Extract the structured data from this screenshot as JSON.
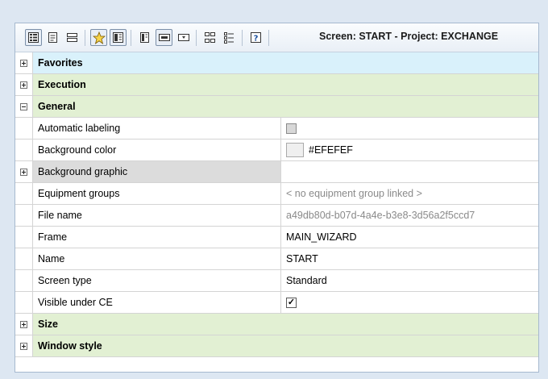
{
  "toolbar": {
    "title": "Screen: START - Project: EXCHANGE",
    "buttons": [
      {
        "icon": "categorized-view-icon",
        "active": true
      },
      {
        "icon": "properties-page-icon",
        "active": false
      },
      {
        "icon": "collapse-icon",
        "active": false
      },
      {
        "icon": "favorites-star-icon",
        "active": true
      },
      {
        "icon": "alphabetical-icon",
        "active": true
      },
      {
        "icon": "detail-view-icon",
        "active": false
      },
      {
        "icon": "input-field-icon",
        "active": true
      },
      {
        "icon": "combo-field-icon",
        "active": false
      },
      {
        "icon": "expand-all-icon",
        "active": false
      },
      {
        "icon": "list-icon",
        "active": false
      },
      {
        "icon": "help-icon",
        "active": false
      }
    ]
  },
  "colors": {
    "favorites_bg": "#d9f1fb",
    "category_bg": "#e2f0d3",
    "grayed_row_bg": "#dcdcdc",
    "swatch": "#EFEFEF"
  },
  "categories": {
    "favorites": "Favorites",
    "execution": "Execution",
    "general": "General",
    "size": "Size",
    "window_style": "Window style"
  },
  "properties": [
    {
      "name": "Automatic labeling",
      "value": "",
      "kind": "checkbox-disabled"
    },
    {
      "name": "Background color",
      "value": "#EFEFEF",
      "kind": "color"
    },
    {
      "name": "Background graphic",
      "value": "",
      "kind": "expandable"
    },
    {
      "name": "Equipment groups",
      "value": "< no equipment group linked >",
      "kind": "muted"
    },
    {
      "name": "File name",
      "value": "a49db80d-b07d-4a4e-b3e8-3d56a2f5ccd7",
      "kind": "muted"
    },
    {
      "name": "Frame",
      "value": "MAIN_WIZARD",
      "kind": "text"
    },
    {
      "name": "Name",
      "value": "START",
      "kind": "text"
    },
    {
      "name": "Screen type",
      "value": "Standard",
      "kind": "text"
    },
    {
      "name": "Visible under CE",
      "value": "checked",
      "kind": "checkbox-checked"
    }
  ]
}
